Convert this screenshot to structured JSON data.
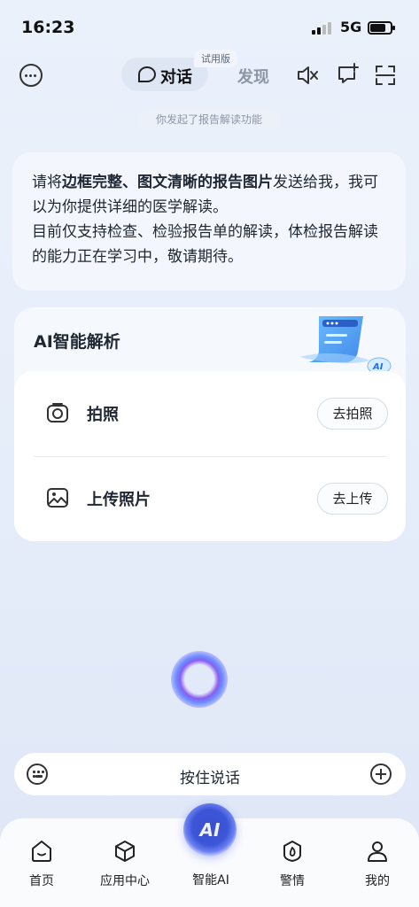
{
  "status_bar": {
    "time": "16:23",
    "network": "5G"
  },
  "top_bar": {
    "tabs": [
      {
        "label": "对话",
        "active": true,
        "badge": "试用版"
      },
      {
        "label": "发现",
        "active": false
      }
    ],
    "icons": [
      "more-icon",
      "chat-bubble-icon",
      "mute-icon",
      "new-chat-icon",
      "scan-icon"
    ]
  },
  "notice": "你发起了报告解读功能",
  "message": {
    "p1_before": "请将",
    "p1_bold": "边框完整、图文清晰的报告图片",
    "p1_after": "发送给我，我可以为你提供详细的医学解读。",
    "p2": "目前仅支持检查、检验报告单的解读，体检报告解读的能力正在学习中，敬请期待。"
  },
  "ai_card": {
    "title": "AI智能解析",
    "rows": [
      {
        "icon": "camera-icon",
        "label": "拍照",
        "action": "去拍照"
      },
      {
        "icon": "image-icon",
        "label": "上传照片",
        "action": "去上传"
      }
    ]
  },
  "voice_bar": {
    "label": "按住说话"
  },
  "nav": {
    "items": [
      {
        "label": "首页",
        "icon": "home-icon"
      },
      {
        "label": "应用中心",
        "icon": "cube-icon"
      },
      {
        "label": "智能AI",
        "icon": "ai-icon",
        "fab_text": "AI"
      },
      {
        "label": "警情",
        "icon": "fire-icon"
      },
      {
        "label": "我的",
        "icon": "user-icon"
      }
    ]
  },
  "colors": {
    "accent": "#3c56d8",
    "orb": "#8a5df0",
    "background": "#e8effa"
  }
}
